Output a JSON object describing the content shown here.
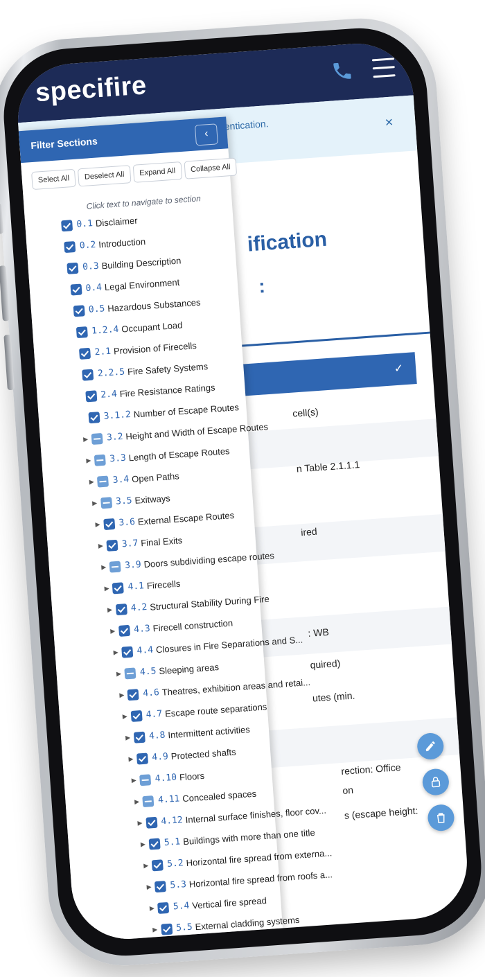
{
  "header": {
    "logo": "specifire"
  },
  "alert": {
    "text": "thentication.",
    "close": "×"
  },
  "page": {
    "title_fragment": "ification",
    "subtitle_fragment": ":"
  },
  "right_rows": [
    "cell(s)",
    "n Table 2.1.1.1",
    "ired",
    ": WB",
    "quired)",
    "utes (min.",
    "rection: Office",
    "on",
    "s (escape height:"
  ],
  "filter": {
    "title": "Filter Sections",
    "collapse_glyph": "‹",
    "actions": [
      "Select All",
      "Deselect All",
      "Expand All",
      "Collapse All"
    ],
    "hint": "Click text to navigate to section",
    "items": [
      {
        "num": "0.1",
        "label": "Disclaimer",
        "state": "checked",
        "caret": false
      },
      {
        "num": "0.2",
        "label": "Introduction",
        "state": "checked",
        "caret": false
      },
      {
        "num": "0.3",
        "label": "Building Description",
        "state": "checked",
        "caret": false
      },
      {
        "num": "0.4",
        "label": "Legal Environment",
        "state": "checked",
        "caret": false
      },
      {
        "num": "0.5",
        "label": "Hazardous Substances",
        "state": "checked",
        "caret": false
      },
      {
        "num": "1.2.4",
        "label": "Occupant Load",
        "state": "checked",
        "caret": false
      },
      {
        "num": "2.1",
        "label": "Provision of Firecells",
        "state": "checked",
        "caret": false
      },
      {
        "num": "2.2.5",
        "label": "Fire Safety Systems",
        "state": "checked",
        "caret": false
      },
      {
        "num": "2.4",
        "label": "Fire Resistance Ratings",
        "state": "checked",
        "caret": false
      },
      {
        "num": "3.1.2",
        "label": "Number of Escape Routes",
        "state": "checked",
        "caret": false
      },
      {
        "num": "3.2",
        "label": "Height and Width of Escape Routes",
        "state": "partial",
        "caret": true
      },
      {
        "num": "3.3",
        "label": "Length of Escape Routes",
        "state": "partial",
        "caret": true
      },
      {
        "num": "3.4",
        "label": "Open Paths",
        "state": "partial",
        "caret": true
      },
      {
        "num": "3.5",
        "label": "Exitways",
        "state": "partial",
        "caret": true
      },
      {
        "num": "3.6",
        "label": "External Escape Routes",
        "state": "checked",
        "caret": true
      },
      {
        "num": "3.7",
        "label": "Final Exits",
        "state": "checked",
        "caret": true
      },
      {
        "num": "3.9",
        "label": "Doors subdividing escape routes",
        "state": "partial",
        "caret": true
      },
      {
        "num": "4.1",
        "label": "Firecells",
        "state": "checked",
        "caret": true
      },
      {
        "num": "4.2",
        "label": "Structural Stability During Fire",
        "state": "checked",
        "caret": true
      },
      {
        "num": "4.3",
        "label": "Firecell construction",
        "state": "checked",
        "caret": true
      },
      {
        "num": "4.4",
        "label": "Closures in Fire Separations and S...",
        "state": "checked",
        "caret": true
      },
      {
        "num": "4.5",
        "label": "Sleeping areas",
        "state": "partial",
        "caret": true
      },
      {
        "num": "4.6",
        "label": "Theatres, exhibition areas and retai...",
        "state": "checked",
        "caret": true
      },
      {
        "num": "4.7",
        "label": "Escape route separations",
        "state": "checked",
        "caret": true
      },
      {
        "num": "4.8",
        "label": "Intermittent activities",
        "state": "checked",
        "caret": true
      },
      {
        "num": "4.9",
        "label": "Protected shafts",
        "state": "checked",
        "caret": true
      },
      {
        "num": "4.10",
        "label": "Floors",
        "state": "partial",
        "caret": true
      },
      {
        "num": "4.11",
        "label": "Concealed spaces",
        "state": "partial",
        "caret": true
      },
      {
        "num": "4.12",
        "label": "Internal surface finishes, floor cov...",
        "state": "checked",
        "caret": true
      },
      {
        "num": "5.1",
        "label": "Buildings with more than one title",
        "state": "checked",
        "caret": true
      },
      {
        "num": "5.2",
        "label": "Horizontal fire spread from externa...",
        "state": "checked",
        "caret": true
      },
      {
        "num": "5.3",
        "label": "Horizontal fire spread from roofs a...",
        "state": "checked",
        "caret": true
      },
      {
        "num": "5.4",
        "label": "Vertical fire spread",
        "state": "checked",
        "caret": true
      },
      {
        "num": "5.5",
        "label": "External cladding systems",
        "state": "checked",
        "caret": true
      }
    ]
  },
  "colors": {
    "header_bg": "#1d2b57",
    "accent": "#2f66b2",
    "alert_bg": "#e4f2fa",
    "fab": "#5b9ad9"
  },
  "icons": [
    "phone-icon",
    "menu-icon",
    "close-icon",
    "chevron-left-icon",
    "check-icon",
    "pencil-icon",
    "lock-icon",
    "trash-icon",
    "caret-right-icon"
  ]
}
